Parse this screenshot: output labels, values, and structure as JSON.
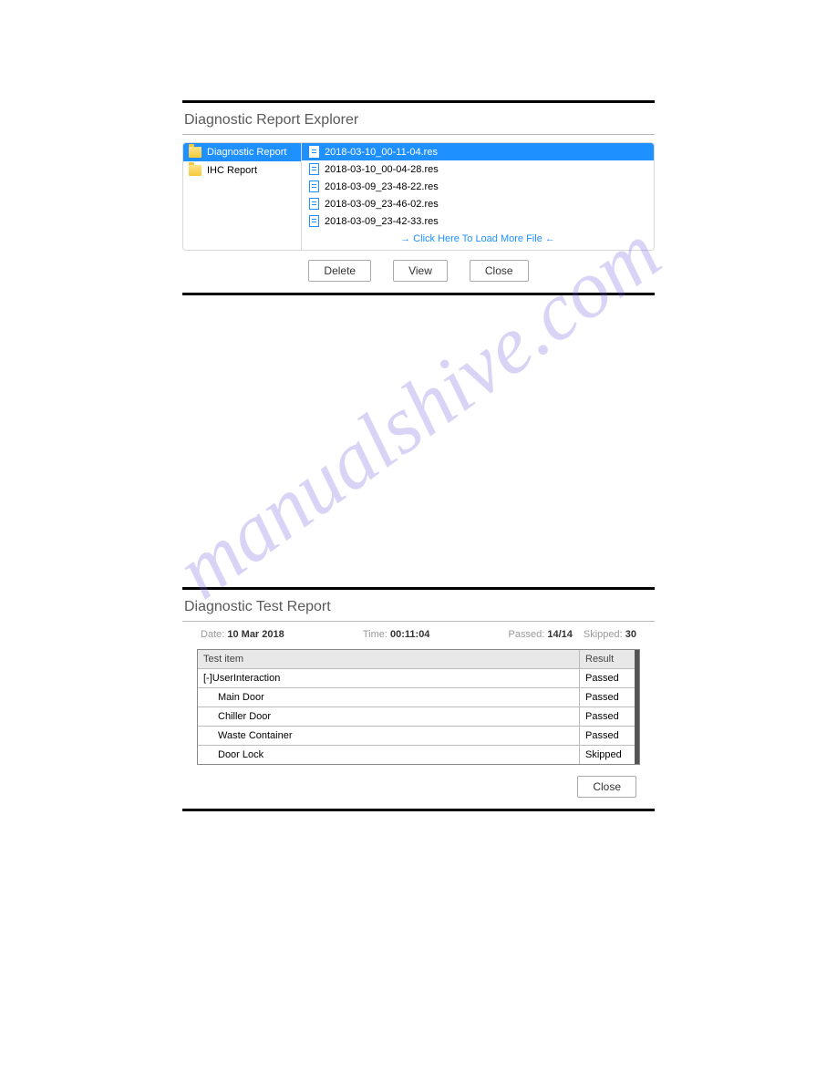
{
  "watermark": "manualshive.com",
  "explorer": {
    "title": "Diagnostic Report Explorer",
    "folders": [
      {
        "label": "Diagnostic Report",
        "selected": true
      },
      {
        "label": "IHC Report",
        "selected": false
      }
    ],
    "files": [
      {
        "name": "2018-03-10_00-11-04.res",
        "selected": true
      },
      {
        "name": "2018-03-10_00-04-28.res",
        "selected": false
      },
      {
        "name": "2018-03-09_23-48-22.res",
        "selected": false
      },
      {
        "name": "2018-03-09_23-46-02.res",
        "selected": false
      },
      {
        "name": "2018-03-09_23-42-33.res",
        "selected": false
      }
    ],
    "load_more": "→ Click Here To Load More File ←",
    "buttons": {
      "delete": "Delete",
      "view": "View",
      "close": "Close"
    }
  },
  "report": {
    "title": "Diagnostic Test Report",
    "meta": {
      "date_label": "Date:",
      "date": "10 Mar 2018",
      "time_label": "Time:",
      "time": "00:11:04",
      "passed_label": "Passed:",
      "passed": "14/14",
      "skipped_label": "Skipped:",
      "skipped": "30"
    },
    "headers": {
      "item": "Test item",
      "result": "Result"
    },
    "rows": [
      {
        "item": "[-]UserInteraction",
        "result": "Passed",
        "indent": 0
      },
      {
        "item": "Main Door",
        "result": "Passed",
        "indent": 1
      },
      {
        "item": "Chiller Door",
        "result": "Passed",
        "indent": 1
      },
      {
        "item": "Waste Container",
        "result": "Passed",
        "indent": 1
      },
      {
        "item": "Door Lock",
        "result": "Skipped",
        "indent": 1
      }
    ],
    "close": "Close"
  }
}
